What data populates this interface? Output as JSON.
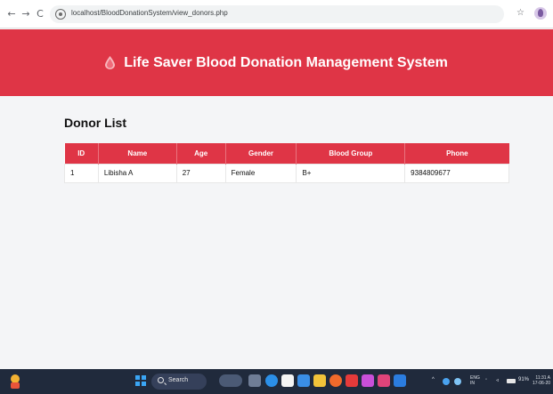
{
  "browser": {
    "back_icon": "←",
    "forward_icon": "→",
    "reload_icon": "C",
    "url": "localhost/BloodDonationSystem/view_donors.php",
    "star_icon": "☆"
  },
  "header": {
    "title": "Life Saver Blood Donation Management System",
    "accent_color": "#df3546"
  },
  "main": {
    "section_title": "Donor List",
    "columns": [
      "ID",
      "Name",
      "Age",
      "Gender",
      "Blood Group",
      "Phone"
    ],
    "rows": [
      {
        "id": "1",
        "name": "Libisha A",
        "age": "27",
        "gender": "Female",
        "blood_group": "B+",
        "phone": "9384809677"
      }
    ]
  },
  "taskbar": {
    "search_placeholder": "Search",
    "lang_top": "ENG",
    "lang_bottom": "IN",
    "battery": "91%",
    "time": "11:31 A",
    "date": "17-06-20"
  }
}
